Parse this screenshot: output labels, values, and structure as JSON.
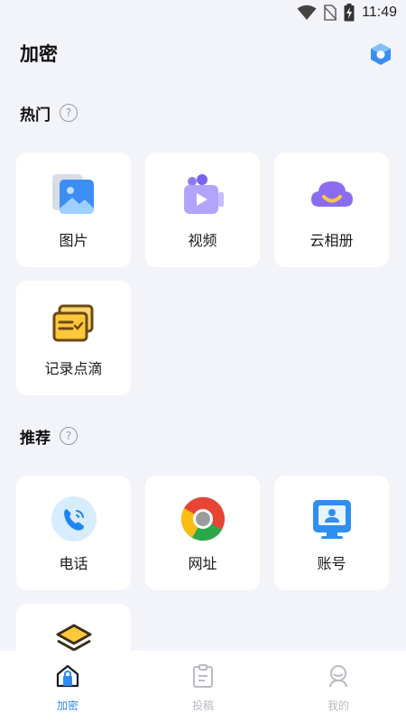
{
  "status_bar": {
    "time": "11:49",
    "icons": [
      "wifi-icon",
      "no-sim-icon",
      "battery-charging-icon"
    ]
  },
  "header": {
    "title": "加密",
    "right_icon": "cube-logo-icon"
  },
  "sections": {
    "hot": {
      "title": "热门",
      "items": [
        "图片",
        "视频",
        "云相册",
        "记录点滴"
      ]
    },
    "recommend": {
      "title": "推荐",
      "items": [
        "电话",
        "网址",
        "账号"
      ]
    }
  },
  "bottom_nav": {
    "items": [
      {
        "label": "加密",
        "icon": "home-lock-icon",
        "active": true
      },
      {
        "label": "投稿",
        "icon": "clipboard-icon",
        "active": false
      },
      {
        "label": "我的",
        "icon": "profile-icon",
        "active": false
      }
    ]
  },
  "colors": {
    "accent": "#2d8cf0",
    "background": "#f3f4f9",
    "inactive": "#b9bbc2"
  }
}
